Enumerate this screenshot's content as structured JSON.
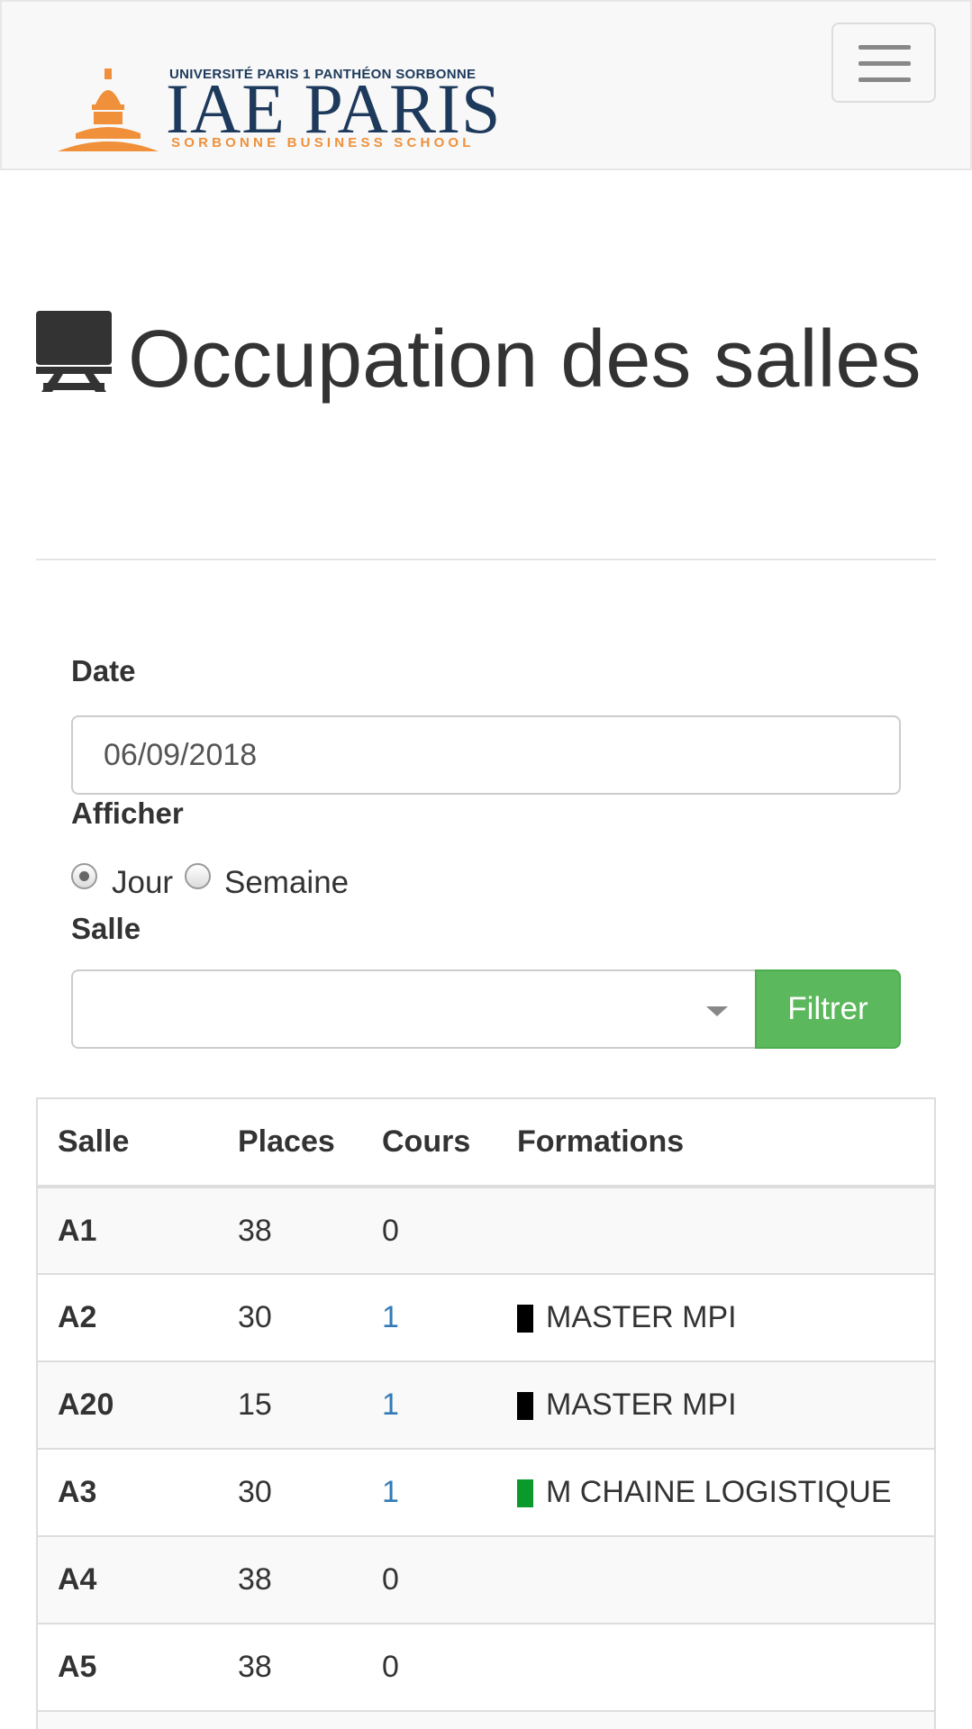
{
  "navbar": {
    "logo": {
      "top_line": "UNIVERSITÉ PARIS 1 PANTHÉON SORBONNE",
      "brand": "IAE PARIS",
      "tagline": "SORBONNE BUSINESS SCHOOL",
      "dome_color": "#f0903a",
      "brand_color": "#1d3a5c"
    },
    "menu_icon": "hamburger-icon"
  },
  "header": {
    "icon": "desk-icon",
    "title": "Occupation des salles"
  },
  "form": {
    "date_label": "Date",
    "date_value": "06/09/2018",
    "display_label": "Afficher",
    "radio_options": [
      {
        "label": "Jour",
        "checked": true
      },
      {
        "label": "Semaine",
        "checked": false
      }
    ],
    "room_label": "Salle",
    "room_value": "",
    "filter_button": "Filtrer",
    "button_color": "#5cb85c"
  },
  "table": {
    "headers": [
      "Salle",
      "Places",
      "Cours",
      "Formations"
    ],
    "rows": [
      {
        "salle": "A1",
        "places": "38",
        "cours": "0",
        "formation": "",
        "swatch": ""
      },
      {
        "salle": "A2",
        "places": "30",
        "cours": "1",
        "formation": "MASTER MPI",
        "swatch": "#000000"
      },
      {
        "salle": "A20",
        "places": "15",
        "cours": "1",
        "formation": "MASTER MPI",
        "swatch": "#000000"
      },
      {
        "salle": "A3",
        "places": "30",
        "cours": "1",
        "formation": "M CHAINE LOGISTIQUE",
        "swatch": "#0a9a2c"
      },
      {
        "salle": "A4",
        "places": "38",
        "cours": "0",
        "formation": "",
        "swatch": ""
      },
      {
        "salle": "A5",
        "places": "38",
        "cours": "0",
        "formation": "",
        "swatch": ""
      },
      {
        "salle": "",
        "places": "",
        "cours": "",
        "formation": "",
        "swatch": ""
      }
    ],
    "link_color": "#337ab7"
  }
}
